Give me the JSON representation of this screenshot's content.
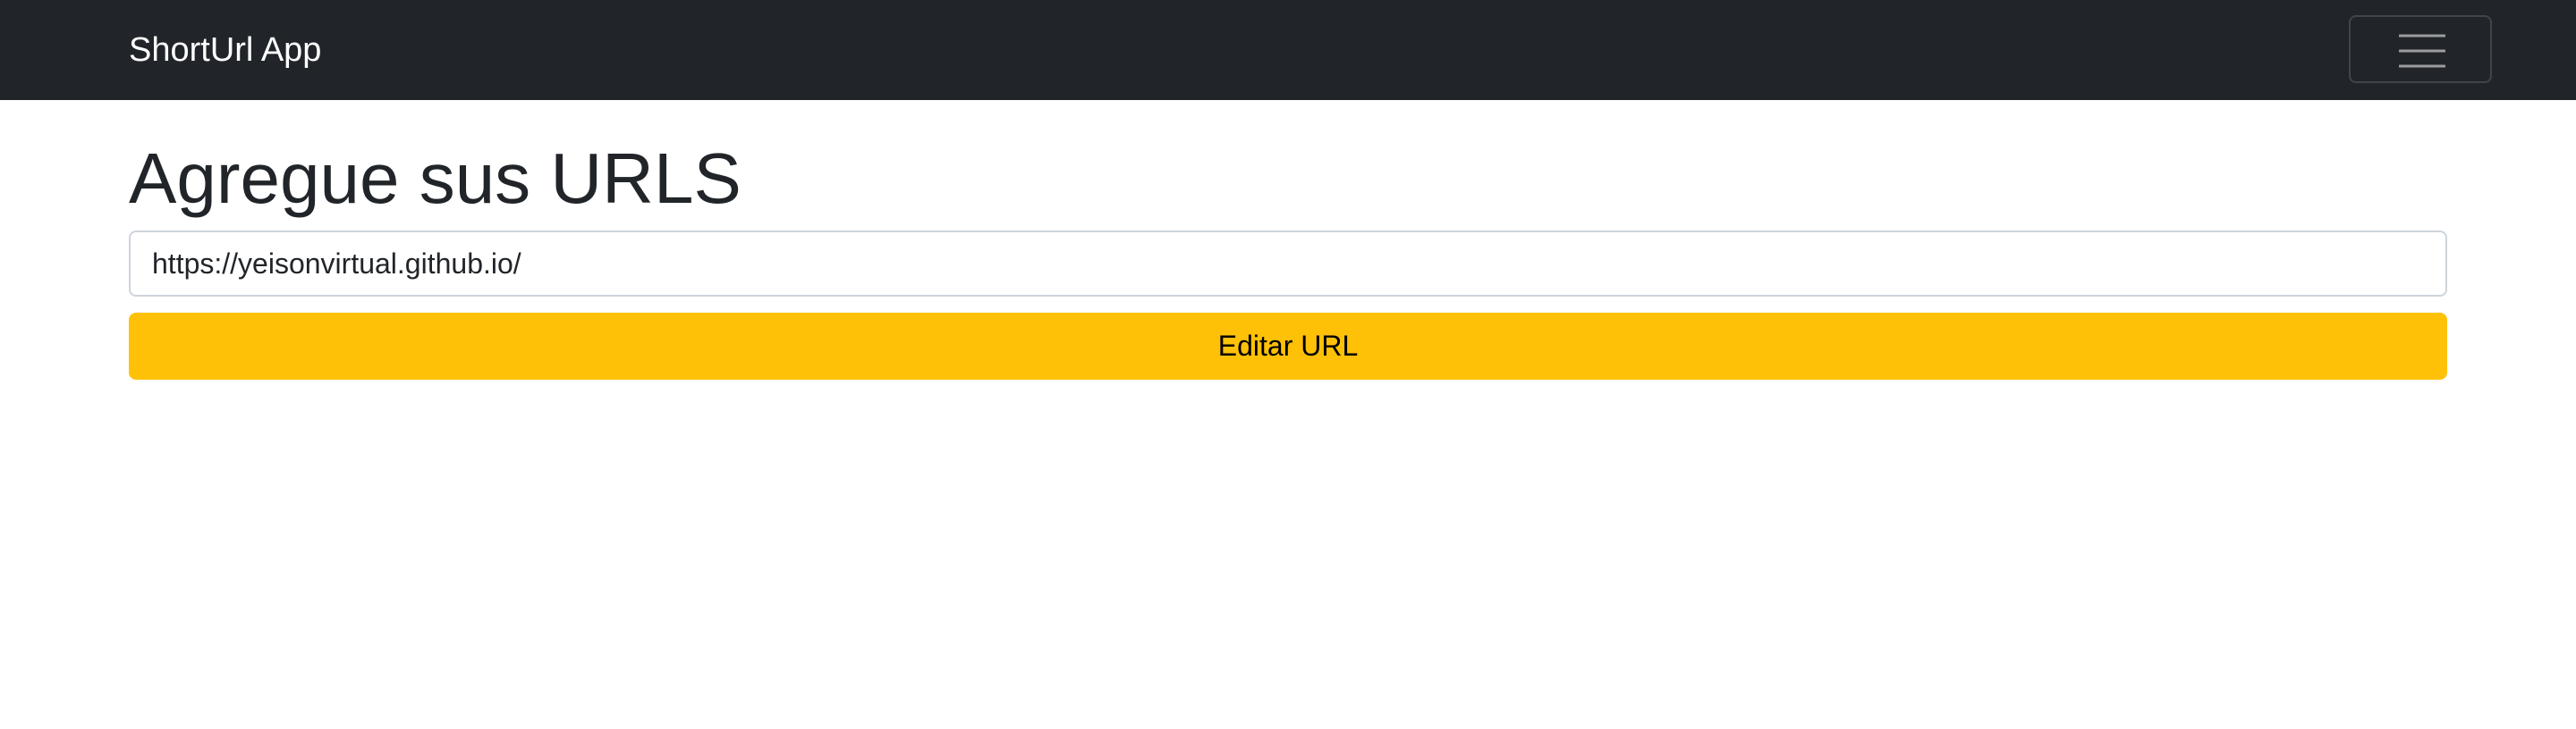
{
  "navbar": {
    "brand": "ShortUrl App",
    "toggler_icon": "hamburger-menu-icon"
  },
  "main": {
    "title": "Agregue sus URLS",
    "url_input": {
      "value": "https://yeisonvirtual.github.io/",
      "placeholder": ""
    },
    "submit_button": {
      "label": "Editar URL"
    }
  },
  "colors": {
    "navbar_bg": "#212529",
    "button_bg": "#ffc107",
    "text": "#212529"
  }
}
